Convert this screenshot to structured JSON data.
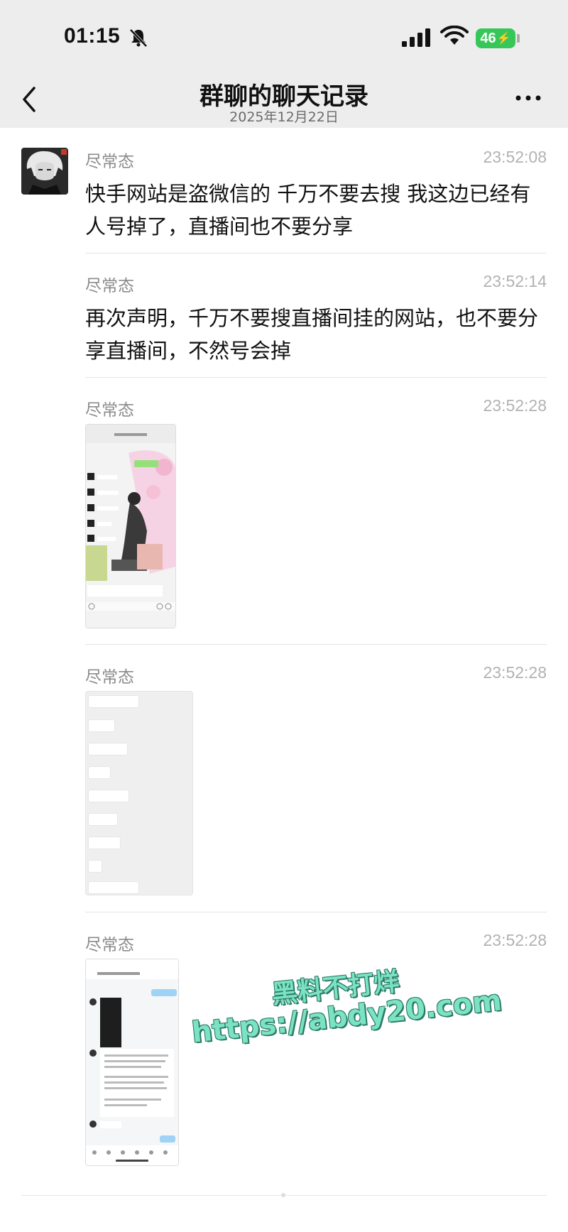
{
  "status_bar": {
    "time": "01:15",
    "battery": "46"
  },
  "header": {
    "title": "群聊的聊天记录",
    "date": "2025年12月22日"
  },
  "messages": [
    {
      "sender": "尽常态",
      "time": "23:52:08",
      "text": "快手网站是盗微信的 千万不要去搜 我这边已经有人号掉了，直播间也不要分享"
    },
    {
      "sender": "尽常态",
      "time": "23:52:14",
      "text": "再次声明，千万不要搜直播间挂的网站，也不要分享直播间，不然号会掉"
    },
    {
      "sender": "尽常态",
      "time": "23:52:28"
    },
    {
      "sender": "尽常态",
      "time": "23:52:28"
    },
    {
      "sender": "尽常态",
      "time": "23:52:28"
    }
  ],
  "watermark": {
    "line1": "黑料不打烊",
    "line2": "https://abdy20.com"
  },
  "icons": [
    "bell-muted-icon",
    "signal-icon",
    "wifi-icon",
    "battery-icon",
    "back-chevron-icon",
    "more-icon"
  ],
  "colors": {
    "header_bg": "#ededed",
    "battery_green": "#37c759",
    "watermark": "#7be3c2"
  }
}
